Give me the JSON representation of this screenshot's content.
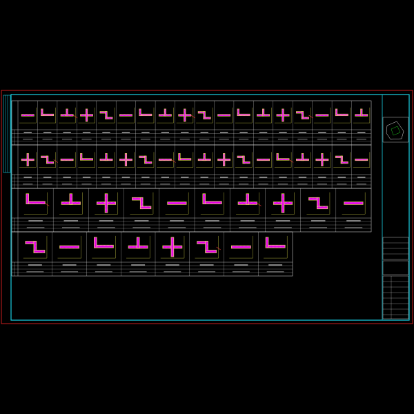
{
  "drawing": {
    "title": "",
    "row_labels": [
      "",
      "",
      "",
      ""
    ],
    "colors": {
      "background": "#000000",
      "outer_frame": "#C81E1E",
      "inner_frame": "#19D2E6",
      "grid": "#E6E6E6",
      "section_fill": "#E600E6",
      "rebar": "#F0F050",
      "text": "#7CFF7C"
    }
  },
  "title_block": {
    "project_name": "",
    "drawing_name": "",
    "fields": []
  },
  "section_counts": [
    18,
    18,
    10,
    8
  ]
}
